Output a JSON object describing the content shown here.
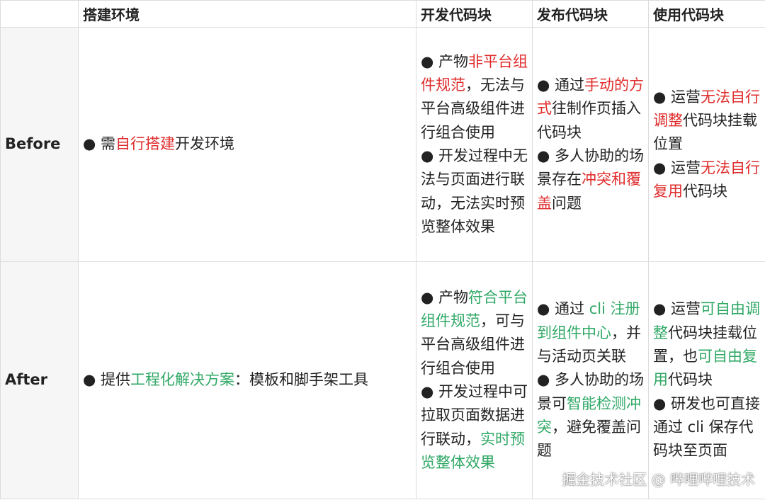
{
  "headers": [
    "",
    "搭建环境",
    "开发代码块",
    "发布代码块",
    "使用代码块"
  ],
  "rows": [
    {
      "id": "before",
      "label": "Before",
      "cells": [
        [
          [
            {
              "t": "● 需"
            },
            {
              "t": "自行搭建",
              "c": "red"
            },
            {
              "t": "开发环境"
            }
          ]
        ],
        [
          [
            {
              "t": "● 产物"
            },
            {
              "t": "非平台组件规范",
              "c": "red"
            },
            {
              "t": "，无法与平台高级组件进行组合使用"
            }
          ],
          [
            {
              "t": "● 开发过程中无法与页面进行联动，无法实时预览整体效果"
            }
          ]
        ],
        [
          [
            {
              "t": "● 通过"
            },
            {
              "t": "手动的方式",
              "c": "red"
            },
            {
              "t": "往制作页插入代码块"
            }
          ],
          [
            {
              "t": "● 多人协助的场景存在"
            },
            {
              "t": "冲突和覆盖",
              "c": "red"
            },
            {
              "t": "问题"
            }
          ]
        ],
        [
          [
            {
              "t": "● 运营"
            },
            {
              "t": "无法自行调整",
              "c": "red"
            },
            {
              "t": "代码块挂载位置"
            }
          ],
          [
            {
              "t": "● 运营"
            },
            {
              "t": "无法自行复用",
              "c": "red"
            },
            {
              "t": "代码块"
            }
          ]
        ]
      ]
    },
    {
      "id": "after",
      "label": "After",
      "cells": [
        [
          [
            {
              "t": "● 提供"
            },
            {
              "t": "工程化解决方案",
              "c": "green"
            },
            {
              "t": "：模板和脚手架工具"
            }
          ]
        ],
        [
          [
            {
              "t": "● 产物"
            },
            {
              "t": "符合平台组件规范",
              "c": "green"
            },
            {
              "t": "，可与平台高级组件进行组合使用"
            }
          ],
          [
            {
              "t": "● 开发过程中可拉取页面数据进行联动，"
            },
            {
              "t": "实时预览整体效果",
              "c": "green"
            }
          ]
        ],
        [
          [
            {
              "t": "● 通过 "
            },
            {
              "t": "cli 注册到组件中心",
              "c": "green"
            },
            {
              "t": "，并与活动页关联"
            }
          ],
          [
            {
              "t": "● 多人协助的场景可"
            },
            {
              "t": "智能检测冲突",
              "c": "green"
            },
            {
              "t": "，避免覆盖问题"
            }
          ]
        ],
        [
          [
            {
              "t": "● 运营"
            },
            {
              "t": "可自由调整",
              "c": "green"
            },
            {
              "t": "代码块挂载位置，也"
            },
            {
              "t": "可自由复用",
              "c": "green"
            },
            {
              "t": "代码块"
            }
          ],
          [
            {
              "t": "● 研发也可直接通过 cli 保存代码块至页面"
            }
          ]
        ]
      ]
    }
  ],
  "watermark": "掘金技术社区 @ 哔哩哔哩技术",
  "colors": {
    "negative": "#e02b2b",
    "positive": "#2fa865"
  }
}
